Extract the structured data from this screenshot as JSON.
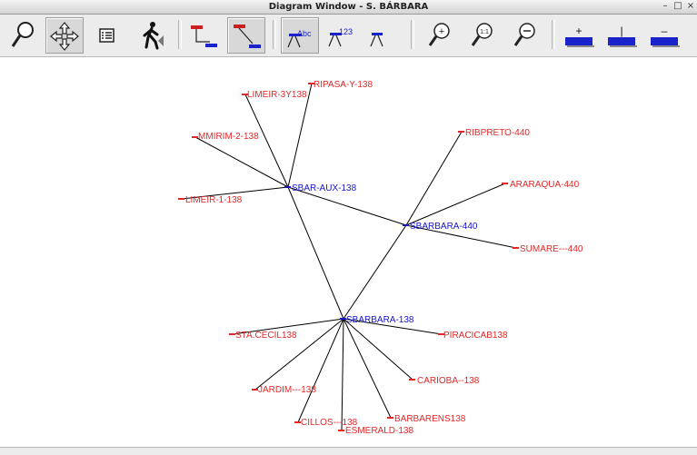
{
  "window": {
    "title": "Diagram Window - S. BÁRBARA",
    "minimize_glyph": "–",
    "maximize_glyph": "□",
    "close_glyph": "×"
  },
  "toolbar": {
    "buttons": [
      {
        "name": "zoom-search",
        "icon": "magnifier-icon",
        "active": false
      },
      {
        "name": "pan",
        "icon": "move-arrows-icon",
        "active": true
      },
      {
        "name": "list",
        "icon": "list-icon",
        "active": false
      },
      {
        "name": "walk",
        "icon": "walking-person-icon",
        "active": false
      },
      {
        "name": "bus-orthogonal",
        "icon": "bus-orthogonal-icon",
        "active": false
      },
      {
        "name": "bus-diagonal",
        "icon": "bus-diagonal-icon",
        "active": true
      },
      {
        "name": "label-text",
        "icon": "label-abc-icon",
        "active": true
      },
      {
        "name": "label-number",
        "icon": "label-123-icon",
        "active": false
      },
      {
        "name": "label-none",
        "icon": "label-none-icon",
        "active": false
      },
      {
        "name": "zoom-in",
        "icon": "zoom-in-icon",
        "active": false
      },
      {
        "name": "zoom-fit",
        "icon": "zoom-1to1-icon",
        "active": false
      },
      {
        "name": "zoom-out",
        "icon": "zoom-out-icon",
        "active": false
      },
      {
        "name": "increase",
        "icon": "plus-bar-icon",
        "active": false
      },
      {
        "name": "normal",
        "icon": "pipe-bar-icon",
        "active": false
      },
      {
        "name": "decrease",
        "icon": "minus-bar-icon",
        "active": false
      }
    ],
    "glyphs": {
      "abc": "Abc",
      "num": "123",
      "plus": "+",
      "pipe": "|",
      "minus": "–",
      "one_to_one": "1:1"
    }
  },
  "colors": {
    "hub": "#1515c8",
    "leaf": "#e02828",
    "line": "#000000",
    "toolbar_red": "#cc1f1f",
    "toolbar_blue": "#1a22cc"
  },
  "diagram": {
    "hubs": [
      {
        "id": "sbar-aux",
        "label": "SBAR-AUX-138"
      },
      {
        "id": "sbarbara440",
        "label": "SBARBARA-440"
      },
      {
        "id": "sbarbara138",
        "label": "SBARBARA-138"
      }
    ],
    "leaves": [
      {
        "id": "limeir3y",
        "label": "LIMEIR-3Y138"
      },
      {
        "id": "ripasa",
        "label": "RIPASA-Y-138"
      },
      {
        "id": "mmirim",
        "label": "MMIRIM-2-138"
      },
      {
        "id": "limeir1",
        "label": "LIMEIR-1-138"
      },
      {
        "id": "ribpreto",
        "label": "RIBPRETO-440"
      },
      {
        "id": "araraqua",
        "label": "ARARAQUA-440"
      },
      {
        "id": "sumare",
        "label": "SUMARE---440"
      },
      {
        "id": "stacecil",
        "label": "STA.CECIL138"
      },
      {
        "id": "piracicab",
        "label": "PIRACICAB138"
      },
      {
        "id": "carioba",
        "label": "CARIOBA--138"
      },
      {
        "id": "jardim",
        "label": "JARDIM---138"
      },
      {
        "id": "cillos",
        "label": "CILLOS---138"
      },
      {
        "id": "esmerald",
        "label": "ESMERALD-138"
      },
      {
        "id": "barbarens",
        "label": "BARBARENS138"
      }
    ],
    "connections": [
      [
        "sbar-aux",
        "limeir3y"
      ],
      [
        "sbar-aux",
        "ripasa"
      ],
      [
        "sbar-aux",
        "mmirim"
      ],
      [
        "sbar-aux",
        "limeir1"
      ],
      [
        "sbar-aux",
        "sbarbara440"
      ],
      [
        "sbar-aux",
        "sbarbara138"
      ],
      [
        "sbarbara440",
        "ribpreto"
      ],
      [
        "sbarbara440",
        "araraqua"
      ],
      [
        "sbarbara440",
        "sumare"
      ],
      [
        "sbarbara440",
        "sbarbara138"
      ],
      [
        "sbarbara138",
        "stacecil"
      ],
      [
        "sbarbara138",
        "piracicab"
      ],
      [
        "sbarbara138",
        "carioba"
      ],
      [
        "sbarbara138",
        "jardim"
      ],
      [
        "sbarbara138",
        "cillos"
      ],
      [
        "sbarbara138",
        "esmerald"
      ],
      [
        "sbarbara138",
        "barbarens"
      ]
    ]
  }
}
